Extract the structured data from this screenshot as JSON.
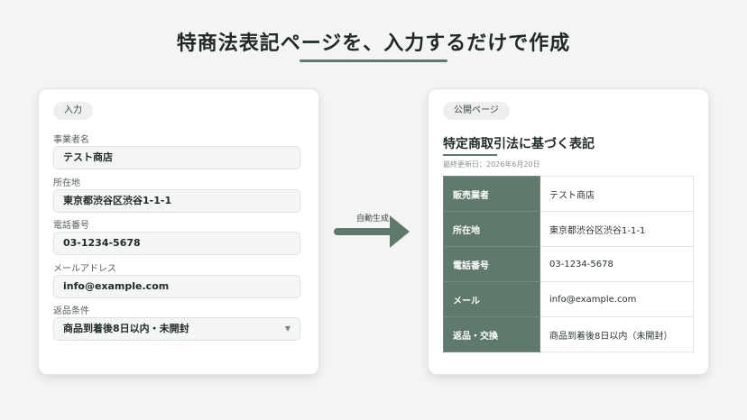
{
  "headline": "特商法表記ページを、入力するだけで作成",
  "input_card": {
    "tag": "入力",
    "fields": [
      {
        "label": "事業者名",
        "value": "テスト商店"
      },
      {
        "label": "所在地",
        "value": "東京都渋谷区渋谷1-1-1"
      },
      {
        "label": "電話番号",
        "value": "03-1234-5678"
      },
      {
        "label": "メールアドレス",
        "value": "info@example.com"
      }
    ],
    "select_field": {
      "label": "返品条件",
      "value": "商品到着後8日以内・未開封"
    }
  },
  "arrow_label": "自動生成",
  "public_card": {
    "tag": "公開ページ",
    "title": "特定商取引法に基づく表記",
    "updated": "最終更新日：2026年6月20日",
    "rows": [
      {
        "header": "販売業者",
        "value": "テスト商店"
      },
      {
        "header": "所在地",
        "value": "東京都渋谷区渋谷1-1-1"
      },
      {
        "header": "電話番号",
        "value": "03-1234-5678"
      },
      {
        "header": "メール",
        "value": "info@example.com"
      },
      {
        "header": "返品・交換",
        "value": "商品到着後8日以内（未開封）"
      }
    ]
  },
  "colors": {
    "accent": "#5f7a6c",
    "background": "#f3f4f3"
  }
}
